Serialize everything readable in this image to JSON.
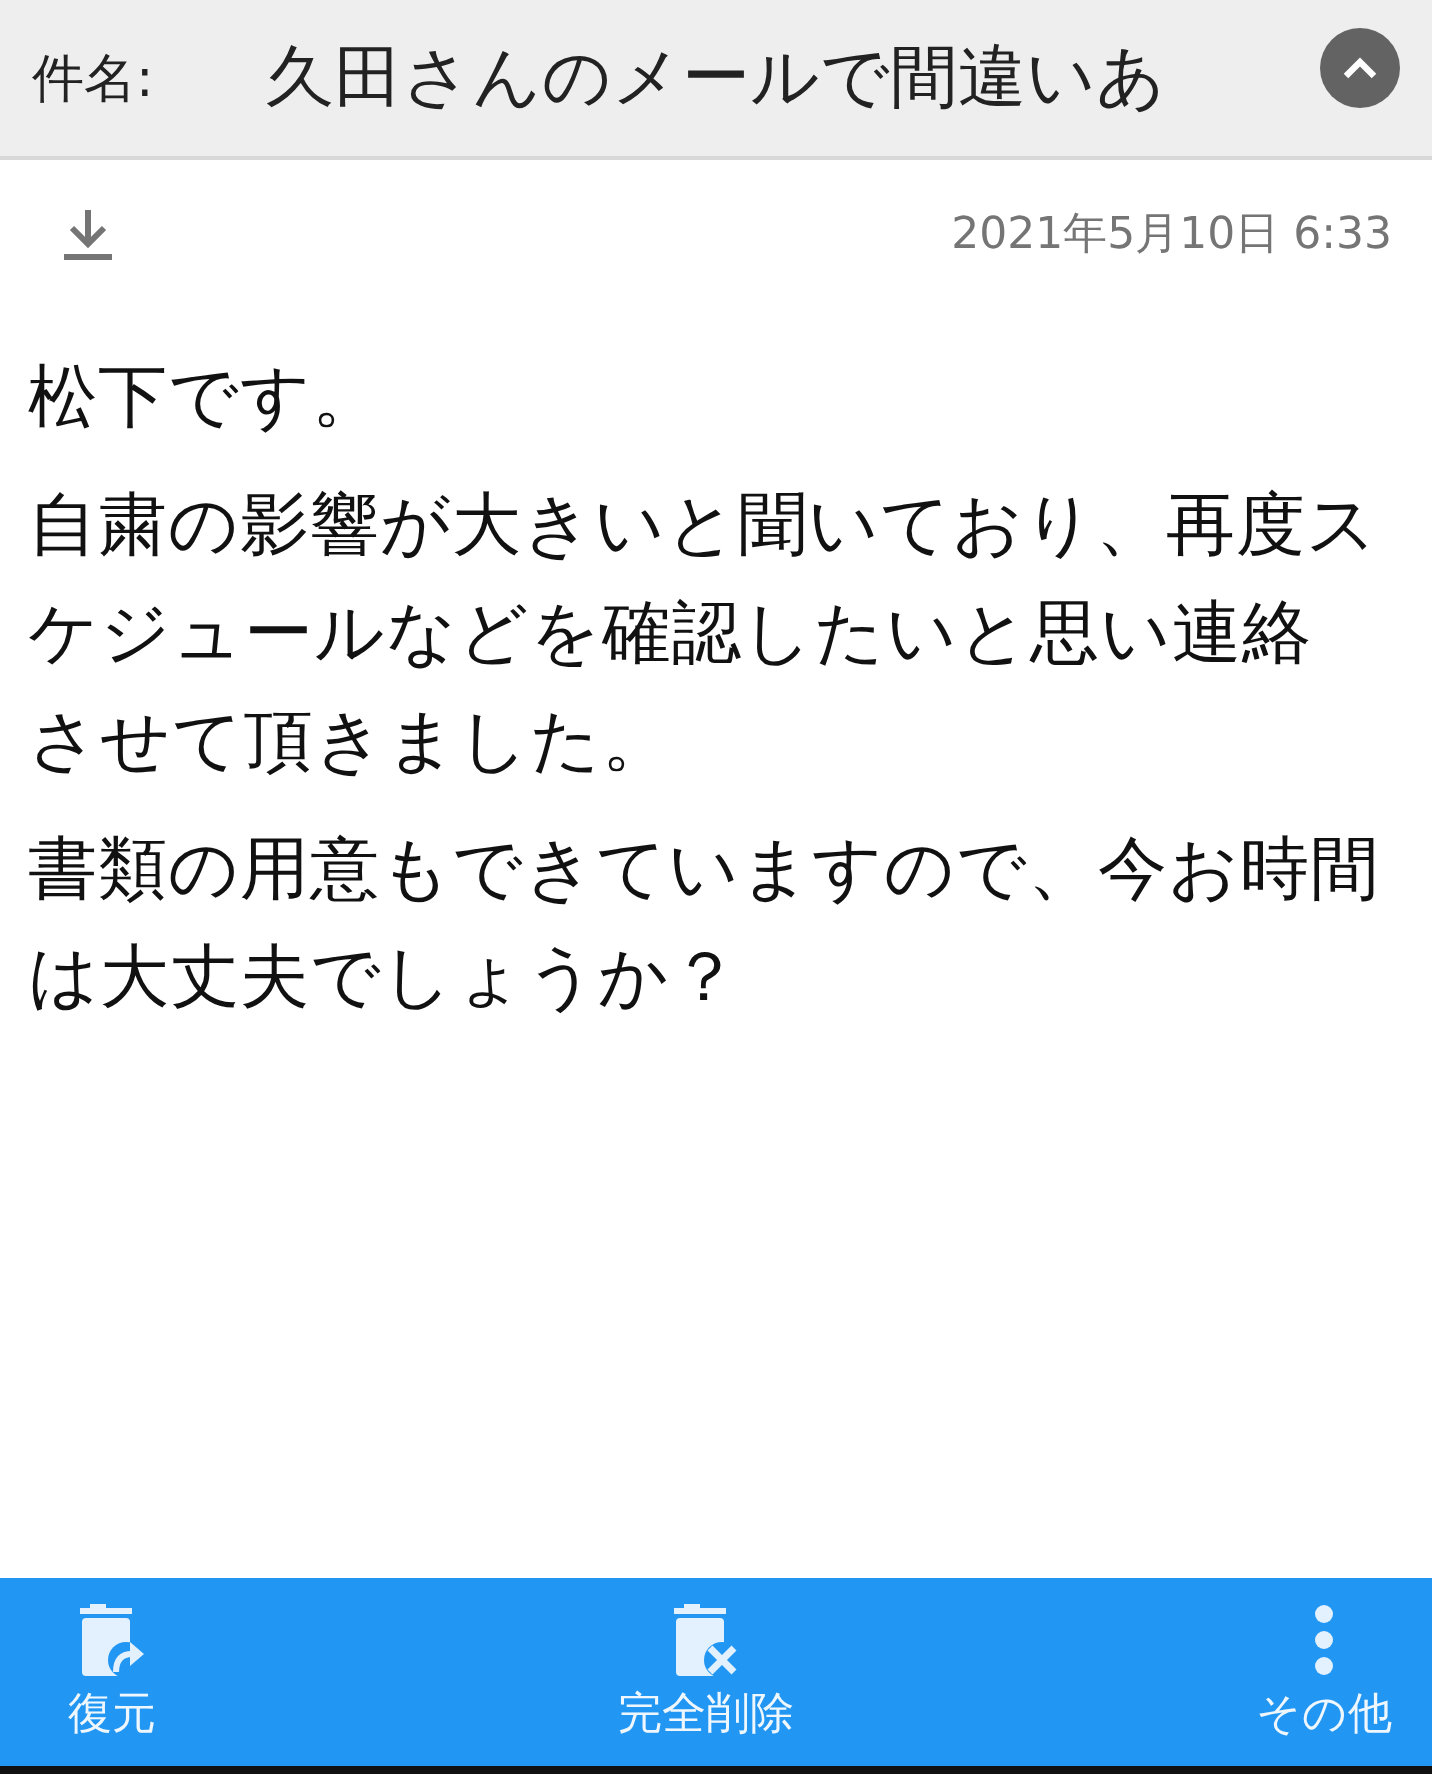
{
  "header": {
    "label": "件名:",
    "subject": "久田さんのメールで間違いあ"
  },
  "date": "2021年5月10日 6:33",
  "body": [
    "松下です。",
    "自粛の影響が大きいと聞いており、再度スケジュールなどを確認したいと思い連絡させて頂きました。",
    "書類の用意もできていますので、今お時間は大丈夫でしょうか？"
  ],
  "toolbar": [
    {
      "kind": "restore",
      "label": "復元"
    },
    {
      "kind": "delete",
      "label": "完全削除"
    },
    {
      "kind": "more",
      "label": "その他"
    }
  ]
}
